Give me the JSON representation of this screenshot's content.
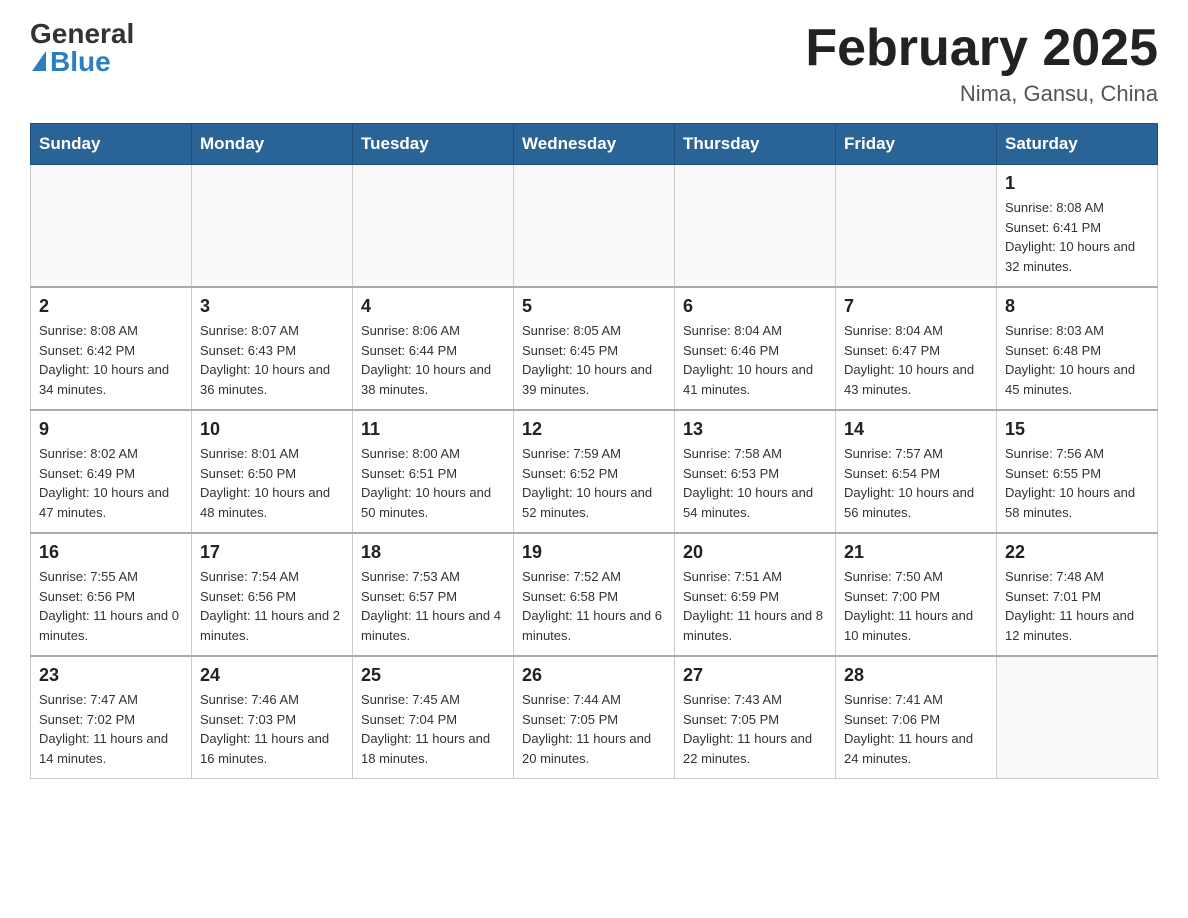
{
  "logo": {
    "general": "General",
    "blue": "Blue"
  },
  "header": {
    "month": "February 2025",
    "location": "Nima, Gansu, China"
  },
  "weekdays": [
    "Sunday",
    "Monday",
    "Tuesday",
    "Wednesday",
    "Thursday",
    "Friday",
    "Saturday"
  ],
  "weeks": [
    [
      {
        "day": "",
        "info": ""
      },
      {
        "day": "",
        "info": ""
      },
      {
        "day": "",
        "info": ""
      },
      {
        "day": "",
        "info": ""
      },
      {
        "day": "",
        "info": ""
      },
      {
        "day": "",
        "info": ""
      },
      {
        "day": "1",
        "info": "Sunrise: 8:08 AM\nSunset: 6:41 PM\nDaylight: 10 hours and 32 minutes."
      }
    ],
    [
      {
        "day": "2",
        "info": "Sunrise: 8:08 AM\nSunset: 6:42 PM\nDaylight: 10 hours and 34 minutes."
      },
      {
        "day": "3",
        "info": "Sunrise: 8:07 AM\nSunset: 6:43 PM\nDaylight: 10 hours and 36 minutes."
      },
      {
        "day": "4",
        "info": "Sunrise: 8:06 AM\nSunset: 6:44 PM\nDaylight: 10 hours and 38 minutes."
      },
      {
        "day": "5",
        "info": "Sunrise: 8:05 AM\nSunset: 6:45 PM\nDaylight: 10 hours and 39 minutes."
      },
      {
        "day": "6",
        "info": "Sunrise: 8:04 AM\nSunset: 6:46 PM\nDaylight: 10 hours and 41 minutes."
      },
      {
        "day": "7",
        "info": "Sunrise: 8:04 AM\nSunset: 6:47 PM\nDaylight: 10 hours and 43 minutes."
      },
      {
        "day": "8",
        "info": "Sunrise: 8:03 AM\nSunset: 6:48 PM\nDaylight: 10 hours and 45 minutes."
      }
    ],
    [
      {
        "day": "9",
        "info": "Sunrise: 8:02 AM\nSunset: 6:49 PM\nDaylight: 10 hours and 47 minutes."
      },
      {
        "day": "10",
        "info": "Sunrise: 8:01 AM\nSunset: 6:50 PM\nDaylight: 10 hours and 48 minutes."
      },
      {
        "day": "11",
        "info": "Sunrise: 8:00 AM\nSunset: 6:51 PM\nDaylight: 10 hours and 50 minutes."
      },
      {
        "day": "12",
        "info": "Sunrise: 7:59 AM\nSunset: 6:52 PM\nDaylight: 10 hours and 52 minutes."
      },
      {
        "day": "13",
        "info": "Sunrise: 7:58 AM\nSunset: 6:53 PM\nDaylight: 10 hours and 54 minutes."
      },
      {
        "day": "14",
        "info": "Sunrise: 7:57 AM\nSunset: 6:54 PM\nDaylight: 10 hours and 56 minutes."
      },
      {
        "day": "15",
        "info": "Sunrise: 7:56 AM\nSunset: 6:55 PM\nDaylight: 10 hours and 58 minutes."
      }
    ],
    [
      {
        "day": "16",
        "info": "Sunrise: 7:55 AM\nSunset: 6:56 PM\nDaylight: 11 hours and 0 minutes."
      },
      {
        "day": "17",
        "info": "Sunrise: 7:54 AM\nSunset: 6:56 PM\nDaylight: 11 hours and 2 minutes."
      },
      {
        "day": "18",
        "info": "Sunrise: 7:53 AM\nSunset: 6:57 PM\nDaylight: 11 hours and 4 minutes."
      },
      {
        "day": "19",
        "info": "Sunrise: 7:52 AM\nSunset: 6:58 PM\nDaylight: 11 hours and 6 minutes."
      },
      {
        "day": "20",
        "info": "Sunrise: 7:51 AM\nSunset: 6:59 PM\nDaylight: 11 hours and 8 minutes."
      },
      {
        "day": "21",
        "info": "Sunrise: 7:50 AM\nSunset: 7:00 PM\nDaylight: 11 hours and 10 minutes."
      },
      {
        "day": "22",
        "info": "Sunrise: 7:48 AM\nSunset: 7:01 PM\nDaylight: 11 hours and 12 minutes."
      }
    ],
    [
      {
        "day": "23",
        "info": "Sunrise: 7:47 AM\nSunset: 7:02 PM\nDaylight: 11 hours and 14 minutes."
      },
      {
        "day": "24",
        "info": "Sunrise: 7:46 AM\nSunset: 7:03 PM\nDaylight: 11 hours and 16 minutes."
      },
      {
        "day": "25",
        "info": "Sunrise: 7:45 AM\nSunset: 7:04 PM\nDaylight: 11 hours and 18 minutes."
      },
      {
        "day": "26",
        "info": "Sunrise: 7:44 AM\nSunset: 7:05 PM\nDaylight: 11 hours and 20 minutes."
      },
      {
        "day": "27",
        "info": "Sunrise: 7:43 AM\nSunset: 7:05 PM\nDaylight: 11 hours and 22 minutes."
      },
      {
        "day": "28",
        "info": "Sunrise: 7:41 AM\nSunset: 7:06 PM\nDaylight: 11 hours and 24 minutes."
      },
      {
        "day": "",
        "info": ""
      }
    ]
  ]
}
